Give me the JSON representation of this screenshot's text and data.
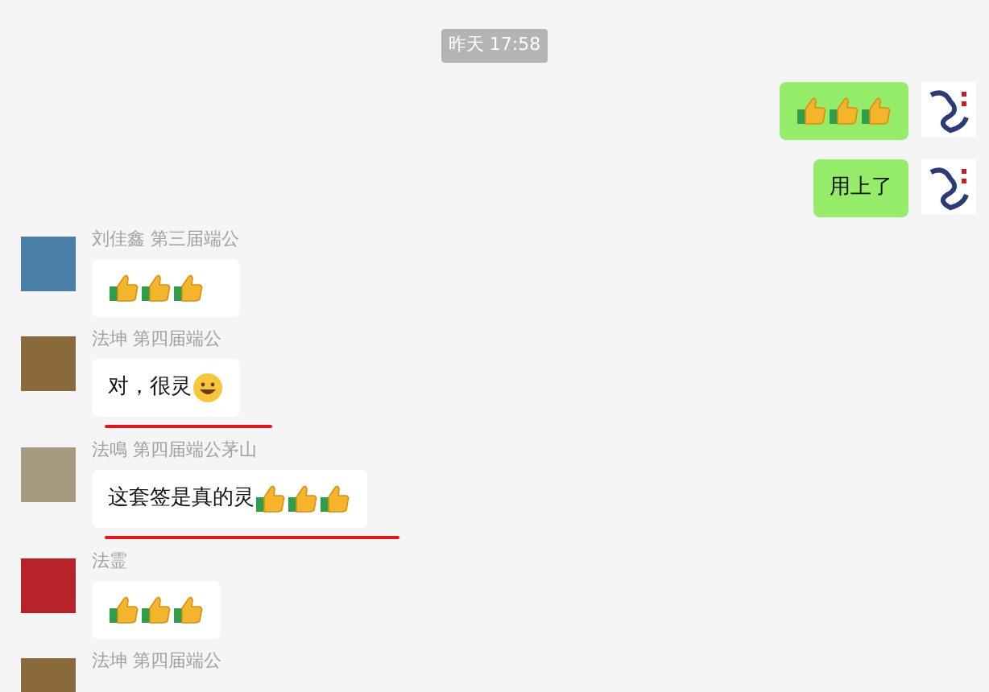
{
  "timestamp": "昨天 17:58",
  "messages": [
    {
      "kind": "sent",
      "parts": [
        {
          "kind": "thumbs"
        },
        {
          "kind": "thumbs"
        },
        {
          "kind": "thumbs"
        }
      ],
      "underlined": false
    },
    {
      "kind": "sent",
      "parts": [
        {
          "kind": "text",
          "text": "用上了"
        }
      ],
      "underlined": false
    },
    {
      "kind": "received",
      "sender": "刘佳鑫 第三届端公",
      "parts": [
        {
          "kind": "thumbs"
        },
        {
          "kind": "thumbs"
        },
        {
          "kind": "thumbs"
        }
      ],
      "underlined": false
    },
    {
      "kind": "received",
      "sender": "法坤 第四届端公",
      "parts": [
        {
          "kind": "text",
          "text": "对，很灵"
        },
        {
          "kind": "grin"
        }
      ],
      "underlined": true
    },
    {
      "kind": "received",
      "sender": "法鳴 第四届端公茅山",
      "parts": [
        {
          "kind": "text",
          "text": "这套签是真的灵"
        },
        {
          "kind": "thumbs"
        },
        {
          "kind": "thumbs"
        },
        {
          "kind": "thumbs"
        }
      ],
      "underlined": true
    },
    {
      "kind": "received",
      "sender": "法霊",
      "parts": [
        {
          "kind": "thumbs"
        },
        {
          "kind": "thumbs"
        },
        {
          "kind": "thumbs"
        }
      ],
      "underlined": false
    },
    {
      "kind": "received",
      "sender": "法坤 第四届端公"
    }
  ]
}
